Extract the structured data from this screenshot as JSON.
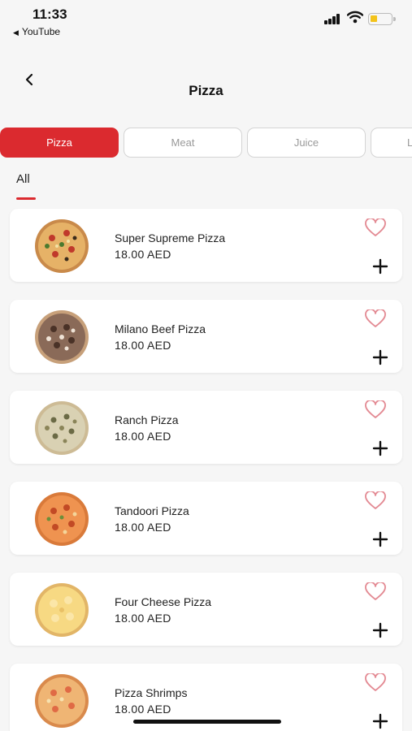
{
  "status": {
    "time": "11:33",
    "back_app": "YouTube"
  },
  "header": {
    "title": "Pizza"
  },
  "categories": [
    {
      "label": "Pizza"
    },
    {
      "label": "Meat"
    },
    {
      "label": "Juice"
    },
    {
      "label": "L"
    }
  ],
  "subtab": {
    "label": "All"
  },
  "products": [
    {
      "name": "Super Supreme Pizza",
      "price": "18.00 AED",
      "icon": "supreme-pizza"
    },
    {
      "name": "Milano Beef Pizza",
      "price": "18.00 AED",
      "icon": "beef-pizza"
    },
    {
      "name": "Ranch Pizza",
      "price": "18.00 AED",
      "icon": "ranch-pizza"
    },
    {
      "name": "Tandoori Pizza",
      "price": "18.00 AED",
      "icon": "tandoori-pizza"
    },
    {
      "name": "Four Cheese Pizza",
      "price": "18.00 AED",
      "icon": "cheese-pizza"
    },
    {
      "name": "Pizza Shrimps",
      "price": "18.00 AED",
      "icon": "shrimp-pizza"
    }
  ],
  "colors": {
    "accent": "#db2a2f",
    "heart": "#e38a93"
  }
}
